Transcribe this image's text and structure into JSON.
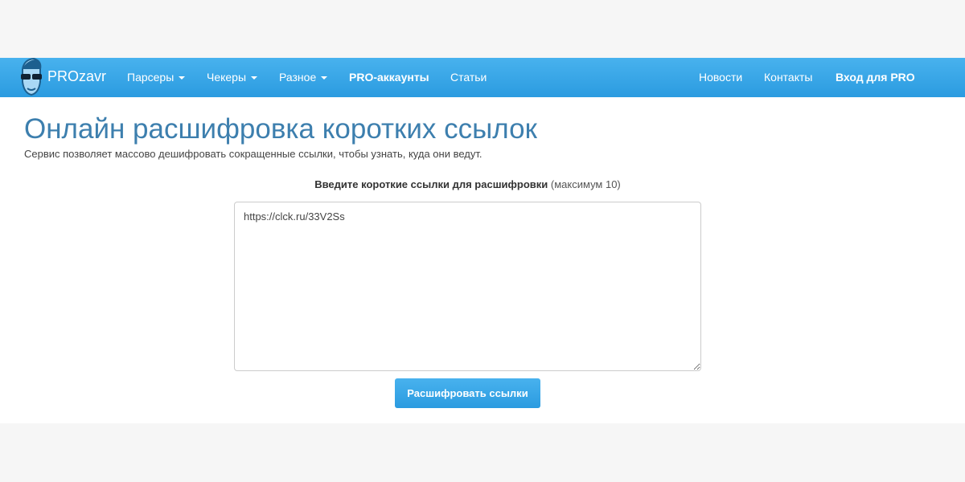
{
  "nav": {
    "brand": "PROzavr",
    "items": [
      "Парсеры",
      "Чекеры",
      "Разное",
      "PRO-аккаунты",
      "Статьи"
    ],
    "right": [
      "Новости",
      "Контакты",
      "Вход для PRO"
    ]
  },
  "page": {
    "title": "Онлайн расшифровка коротких ссылок",
    "description": "Сервис позволяет массово дешифровать сокращенные ссылки, чтобы узнать, куда они ведут.",
    "label_bold": "Введите короткие ссылки для расшифровки",
    "label_note": "(максимум 10)",
    "textarea_value": "https://clck.ru/33V2Ss",
    "submit": "Расшифровать ссылки"
  }
}
